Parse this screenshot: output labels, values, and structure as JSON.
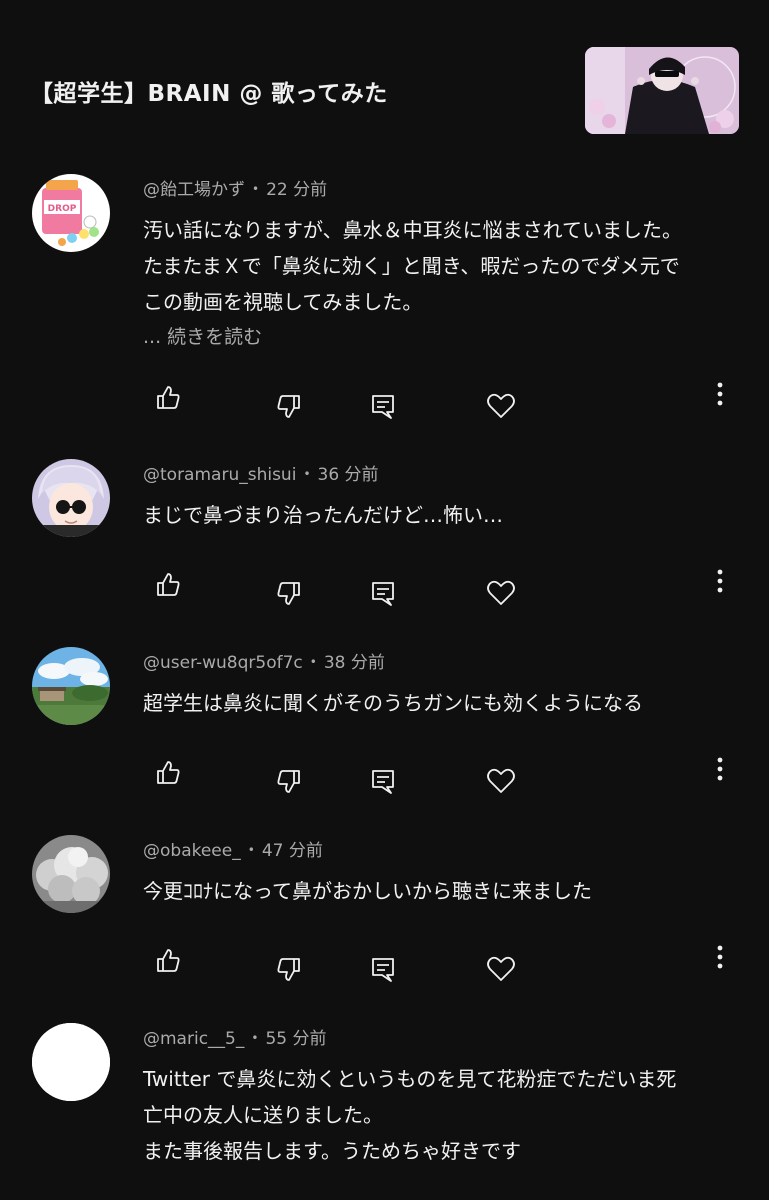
{
  "video": {
    "title": "【超学生】BRAIN @ 歌ってみた",
    "thumbnail_icon": "video-thumbnail"
  },
  "comments": [
    {
      "author": "@飴工場かず",
      "time": "22 分前",
      "lines": [
        "汚い話になりますが、鼻水＆中耳炎に悩まされていました。",
        "たまたまＸで「鼻炎に効く」と聞き、暇だったのでダメ元で",
        "この動画を視聴してみました。"
      ],
      "more": "... 続きを読む",
      "avatar": "candy-drop-avatar"
    },
    {
      "author": "@toramaru_shisui",
      "time": "36 分前",
      "lines": [
        "まじで鼻づまり治ったんだけど…怖い…"
      ],
      "avatar": "anime-character-avatar"
    },
    {
      "author": "@user-wu8qr5of7c",
      "time": "38 分前",
      "lines": [
        "超学生は鼻炎に聞くがそのうちガンにも効くようになる"
      ],
      "avatar": "landscape-avatar"
    },
    {
      "author": "@obakeee_",
      "time": "47 分前",
      "lines": [
        "今更ｺﾛﾅになって鼻がおかしいから聴きに来ました"
      ],
      "avatar": "clouds-avatar"
    },
    {
      "author": "@maric__5_",
      "time": "55 分前",
      "lines": [
        "Twitter で鼻炎に効くというものを見て花粉症でただいま死",
        "亡中の友人に送りました。",
        "また事後報告します。うためちゃ好きです"
      ],
      "avatar": "blank-white-avatar"
    }
  ],
  "colors": {
    "background": "#0f0f0f",
    "text": "#f1f1f1",
    "secondary": "#aaaaaa"
  }
}
